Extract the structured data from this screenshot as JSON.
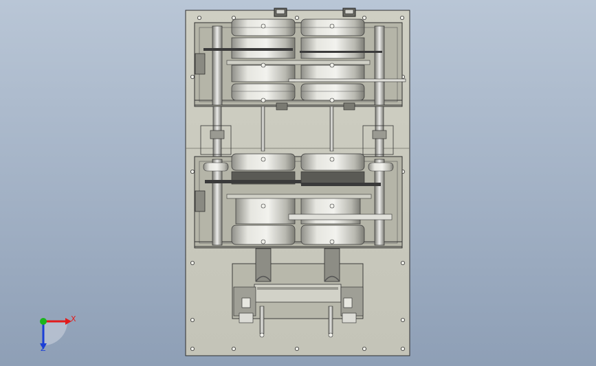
{
  "viewport": {
    "background_top": "#b9c6d6",
    "background_bottom": "#8e9fb6"
  },
  "model": {
    "plate_color": "#c9c9bd",
    "frame_color": "#b8b8ab",
    "edge_color": "#2e2e2e",
    "drum_color": "#d8d8d2",
    "drum_shadow": "#9c9c94",
    "belt_color": "#3a3a3a"
  },
  "triad": {
    "x_label": "X",
    "z_label": "Z",
    "x_color": "#e21b1b",
    "y_color": "#1bb51b",
    "z_color": "#1b3fd6"
  }
}
